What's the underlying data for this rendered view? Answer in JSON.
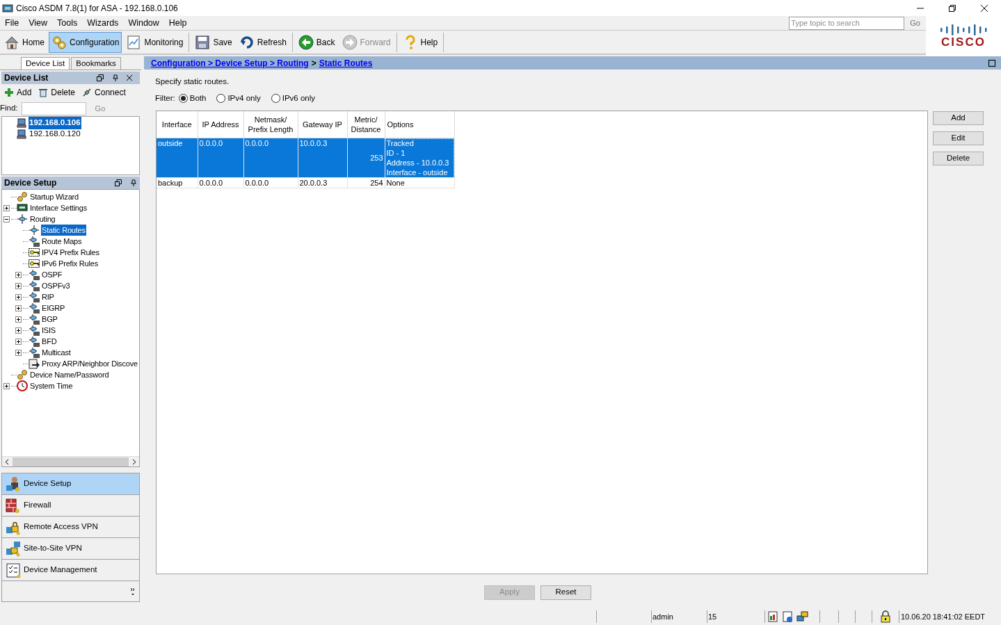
{
  "window": {
    "title": "Cisco ASDM 7.8(1) for ASA - 192.168.0.106"
  },
  "menu": [
    "File",
    "View",
    "Tools",
    "Wizards",
    "Window",
    "Help"
  ],
  "help_search": {
    "placeholder": "Type topic to search",
    "button": "Go"
  },
  "logo": {
    "text": "CISCO"
  },
  "toolbar": [
    {
      "label": "Home",
      "selected": false,
      "disabled": false
    },
    {
      "label": "Configuration",
      "selected": true,
      "disabled": false
    },
    {
      "label": "Monitoring",
      "selected": false,
      "disabled": false
    },
    {
      "label": "Save",
      "selected": false,
      "disabled": false
    },
    {
      "label": "Refresh",
      "selected": false,
      "disabled": false
    },
    {
      "label": "Back",
      "selected": false,
      "disabled": false
    },
    {
      "label": "Forward",
      "selected": false,
      "disabled": true
    },
    {
      "label": "Help",
      "selected": false,
      "disabled": false
    }
  ],
  "left_tabs": [
    {
      "label": "Device List",
      "selected": true
    },
    {
      "label": "Bookmarks",
      "selected": false
    }
  ],
  "device_list": {
    "title": "Device List",
    "actions": [
      "Add",
      "Delete",
      "Connect"
    ],
    "find_label": "Find:",
    "find_button": "Go",
    "devices": [
      {
        "label": "192.168.0.106",
        "selected": true
      },
      {
        "label": "192.168.0.120",
        "selected": false
      }
    ]
  },
  "device_setup": {
    "title": "Device Setup",
    "tree": [
      {
        "label": "Startup Wizard",
        "kind": "wizard",
        "selected": false
      },
      {
        "label": "Interface Settings",
        "kind": "interface",
        "expanded": false,
        "selected": false
      },
      {
        "label": "Routing",
        "kind": "routing",
        "expanded": true,
        "selected": false,
        "children": [
          {
            "label": "Static Routes",
            "kind": "routing",
            "selected": true
          },
          {
            "label": "Route Maps",
            "kind": "router",
            "selected": false
          },
          {
            "label": "IPV4 Prefix Rules",
            "kind": "key",
            "selected": false
          },
          {
            "label": "IPv6 Prefix Rules",
            "kind": "key",
            "selected": false
          },
          {
            "label": "OSPF",
            "kind": "router",
            "expanded": false,
            "selected": false
          },
          {
            "label": "OSPFv3",
            "kind": "router",
            "expanded": false,
            "selected": false
          },
          {
            "label": "RIP",
            "kind": "router",
            "expanded": false,
            "selected": false
          },
          {
            "label": "EIGRP",
            "kind": "router",
            "expanded": false,
            "selected": false
          },
          {
            "label": "BGP",
            "kind": "router",
            "expanded": false,
            "selected": false
          },
          {
            "label": "ISIS",
            "kind": "router",
            "expanded": false,
            "selected": false
          },
          {
            "label": "BFD",
            "kind": "router",
            "expanded": false,
            "selected": false
          },
          {
            "label": "Multicast",
            "kind": "router",
            "expanded": false,
            "selected": false
          },
          {
            "label": "Proxy ARP/Neighbor Discove",
            "kind": "proxy",
            "selected": false
          }
        ]
      },
      {
        "label": "Device Name/Password",
        "kind": "wizard",
        "selected": false
      },
      {
        "label": "System Time",
        "kind": "clock",
        "expanded": false,
        "selected": false
      }
    ]
  },
  "nav_buttons": [
    {
      "label": "Device Setup",
      "selected": true
    },
    {
      "label": "Firewall",
      "selected": false
    },
    {
      "label": "Remote Access VPN",
      "selected": false
    },
    {
      "label": "Site-to-Site VPN",
      "selected": false
    },
    {
      "label": "Device Management",
      "selected": false
    }
  ],
  "breadcrumb": [
    {
      "kind": "link",
      "text": "Configuration > Device Setup > Routing"
    },
    {
      "kind": "plain",
      "text": ">"
    },
    {
      "kind": "link",
      "text": "Static Routes"
    }
  ],
  "description": "Specify static routes.",
  "filter": {
    "label": "Filter:",
    "options": [
      {
        "label": "Both",
        "selected": true
      },
      {
        "label": "IPv4 only",
        "selected": false
      },
      {
        "label": "IPv6 only",
        "selected": false
      }
    ]
  },
  "table": {
    "columns": [
      "Interface",
      "IP Address",
      "Netmask/\nPrefix Length",
      "Gateway IP",
      "Metric/\nDistance",
      "Options"
    ],
    "rows": [
      {
        "selected": true,
        "cells": [
          "outside",
          "0.0.0.0",
          "0.0.0.0",
          "10.0.0.3",
          "253",
          "Tracked\nID - 1\nAddress - 10.0.0.3\nInterface - outside"
        ]
      },
      {
        "selected": false,
        "cells": [
          "backup",
          "0.0.0.0",
          "0.0.0.0",
          "20.0.0.3",
          "254",
          "None"
        ]
      }
    ]
  },
  "side_buttons": [
    "Add",
    "Edit",
    "Delete"
  ],
  "bottom_buttons": [
    {
      "label": "Apply",
      "disabled": true
    },
    {
      "label": "Reset",
      "disabled": false
    }
  ],
  "status_bar": {
    "user": "admin",
    "privilege": "15",
    "time": "10.06.20 18:41:02 EEDT"
  }
}
